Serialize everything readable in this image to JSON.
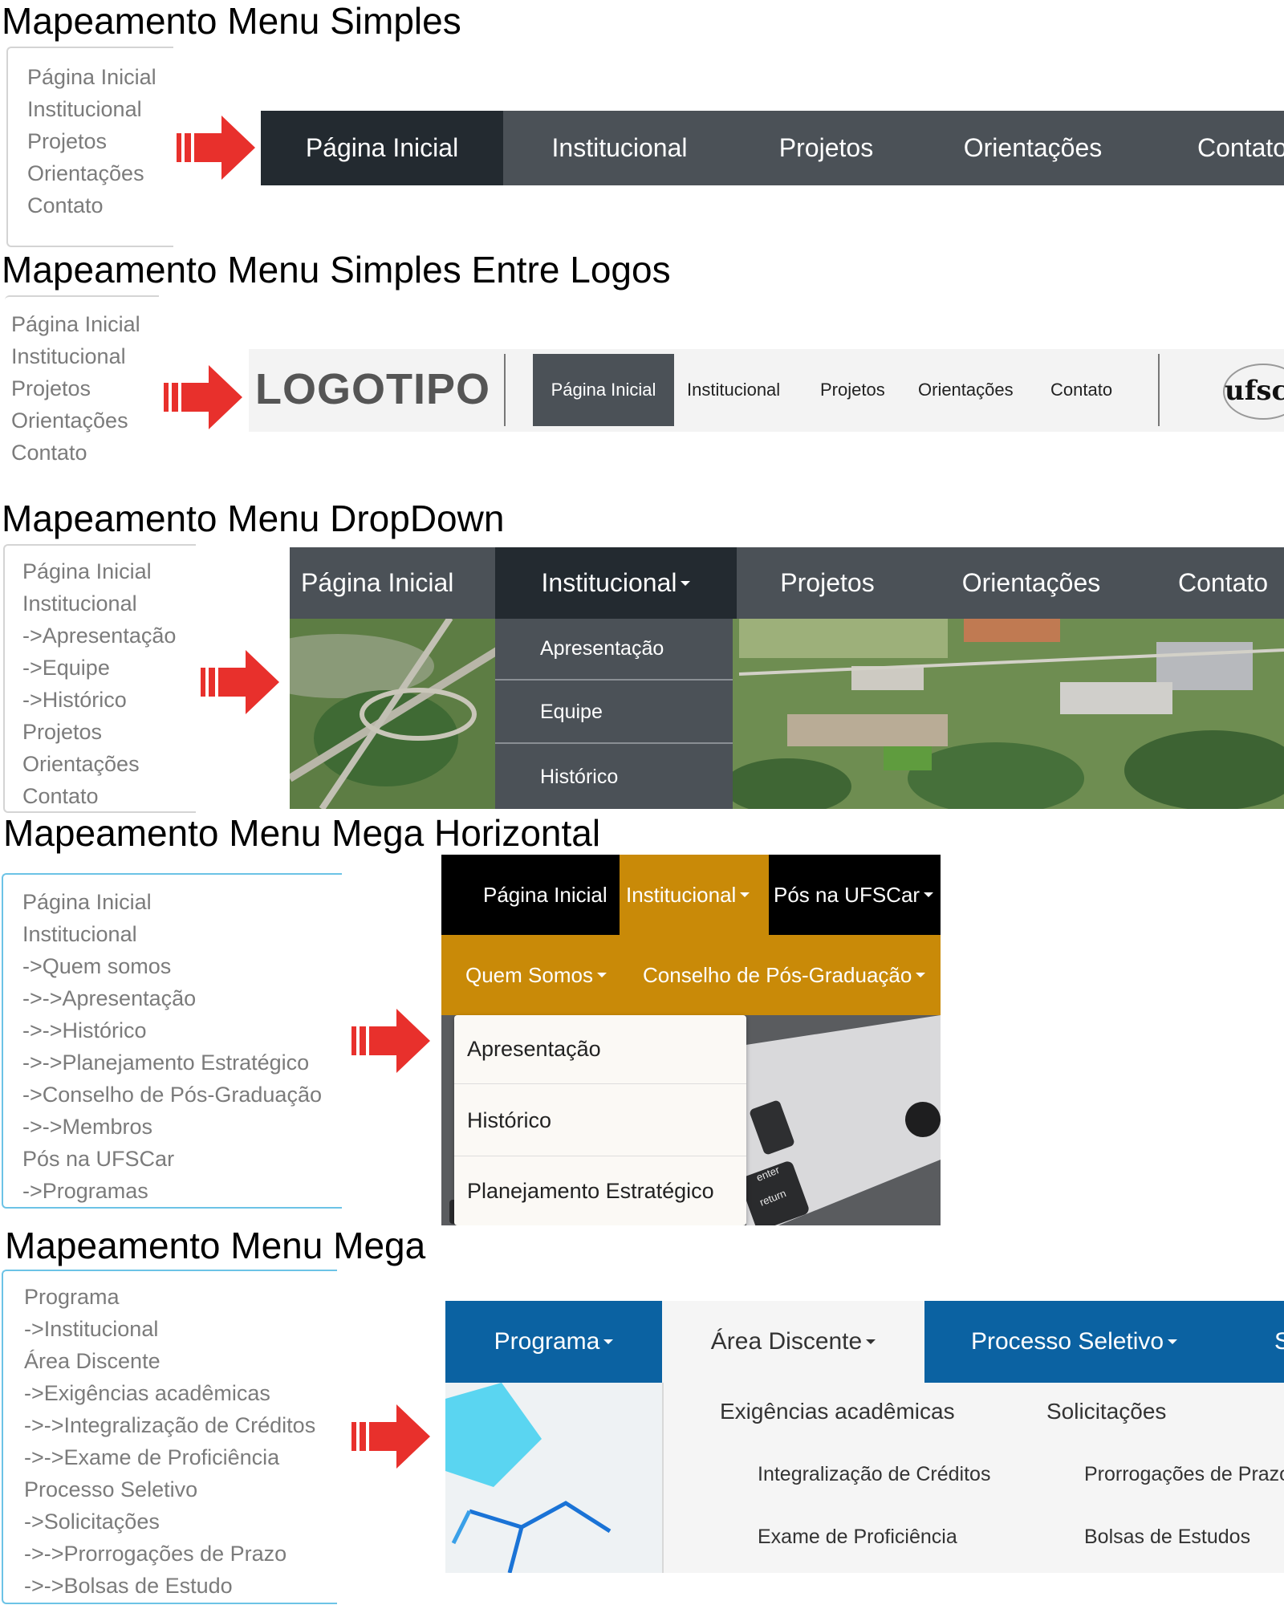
{
  "s1": {
    "title": "Mapeamento Menu Simples",
    "list": [
      "Página Inicial",
      "Institucional",
      "Projetos",
      "Orientações",
      "Contato"
    ],
    "nav": [
      "Página Inicial",
      "Institucional",
      "Projetos",
      "Orientações",
      "Contato"
    ]
  },
  "s2": {
    "title": "Mapeamento Menu Simples Entre Logos",
    "list": [
      "Página Inicial",
      "Institucional",
      "Projetos",
      "Orientações",
      "Contato"
    ],
    "logo": "LOGOTIPO",
    "nav": [
      "Página Inicial",
      "Institucional",
      "Projetos",
      "Orientações",
      "Contato"
    ],
    "right_logo": "ufsc"
  },
  "s3": {
    "title": "Mapeamento Menu DropDown",
    "list": [
      "Página Inicial",
      "Institucional",
      "->Apresentação",
      "->Equipe",
      "->Histórico",
      "Projetos",
      "Orientações",
      "Contato"
    ],
    "nav": [
      "Página Inicial",
      "Institucional",
      "Projetos",
      "Orientações",
      "Contato"
    ],
    "dropdown": [
      "Apresentação",
      "Equipe",
      "Histórico"
    ]
  },
  "s4": {
    "title": "Mapeamento Menu Mega Horizontal",
    "list": [
      "Página Inicial",
      "Institucional",
      "->Quem somos",
      "->->Apresentação",
      "->->Histórico",
      "->->Planejamento Estratégico",
      "->Conselho de Pós-Graduação",
      "->->Membros",
      "Pós na UFSCar",
      "->Programas"
    ],
    "nav": [
      "Página Inicial",
      "Institucional",
      "Pós na UFSCar"
    ],
    "subnav": [
      "Quem Somos",
      "Conselho de Pós-Graduação"
    ],
    "dropdown": [
      "Apresentação",
      "Histórico",
      "Planejamento Estratégico"
    ],
    "key_labels": [
      "enter",
      "return"
    ]
  },
  "s5": {
    "title": "Mapeamento Menu Mega",
    "list": [
      "Programa",
      "->Institucional",
      "Área Discente",
      "->Exigências acadêmicas",
      "->->Integralização de Créditos",
      "->->Exame de Proficiência",
      "Processo Seletivo",
      "->Solicitações",
      "->->Prorrogações de Prazo",
      "->->Bolsas de Estudo"
    ],
    "nav": [
      "Programa",
      "Área Discente",
      "Processo Seletivo",
      "S"
    ],
    "mega": {
      "col1_header": "Exigências acadêmicas",
      "col1_items": [
        "Integralização de Créditos",
        "Exame de Proficiência"
      ],
      "col2_header": "Solicitações",
      "col2_items": [
        "Prorrogações de Prazo",
        "Bolsas de Estudos"
      ]
    }
  },
  "colors": {
    "dark_nav": "#4b5157",
    "dark_active": "#232a30",
    "orange": "#c98a08",
    "black": "#000000",
    "blue": "#0b62a2",
    "arrow": "#e8302c",
    "list_text": "#7b7b7b"
  }
}
